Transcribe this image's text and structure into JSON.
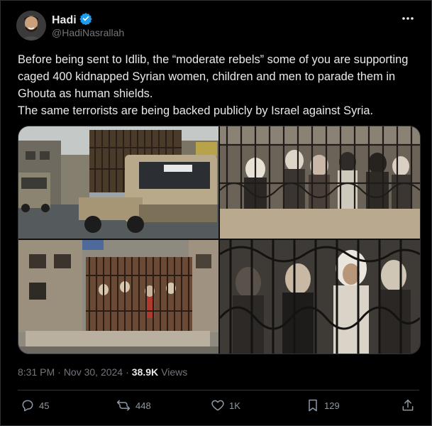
{
  "author": {
    "name": "Hadi",
    "handle": "@HadiNasrallah",
    "verified_color": "#1d9bf0"
  },
  "tweet": {
    "lines": [
      "Before being sent to Idlib, the “moderate rebels” some of you are supporting caged 400 kidnapped Syrian women, children and men to parade them in Ghouta as human shields.",
      "The same terrorists are being backed publicly by Israel against Syria."
    ]
  },
  "meta": {
    "time": "8:31 PM",
    "separator": "·",
    "date": "Nov 30, 2024",
    "views_count": "38.9K",
    "views_label": "Views"
  },
  "actions": {
    "replies": "45",
    "reposts": "448",
    "likes": "1K",
    "bookmarks": "129"
  },
  "icons": [
    "more-icon",
    "verified-badge-icon",
    "reply-icon",
    "repost-icon",
    "like-icon",
    "bookmark-icon",
    "share-icon"
  ],
  "colors": {
    "background": "#000000",
    "text": "#e7e9ea",
    "muted": "#71767b",
    "link": "#1d9bf0",
    "border": "#2f3336"
  }
}
